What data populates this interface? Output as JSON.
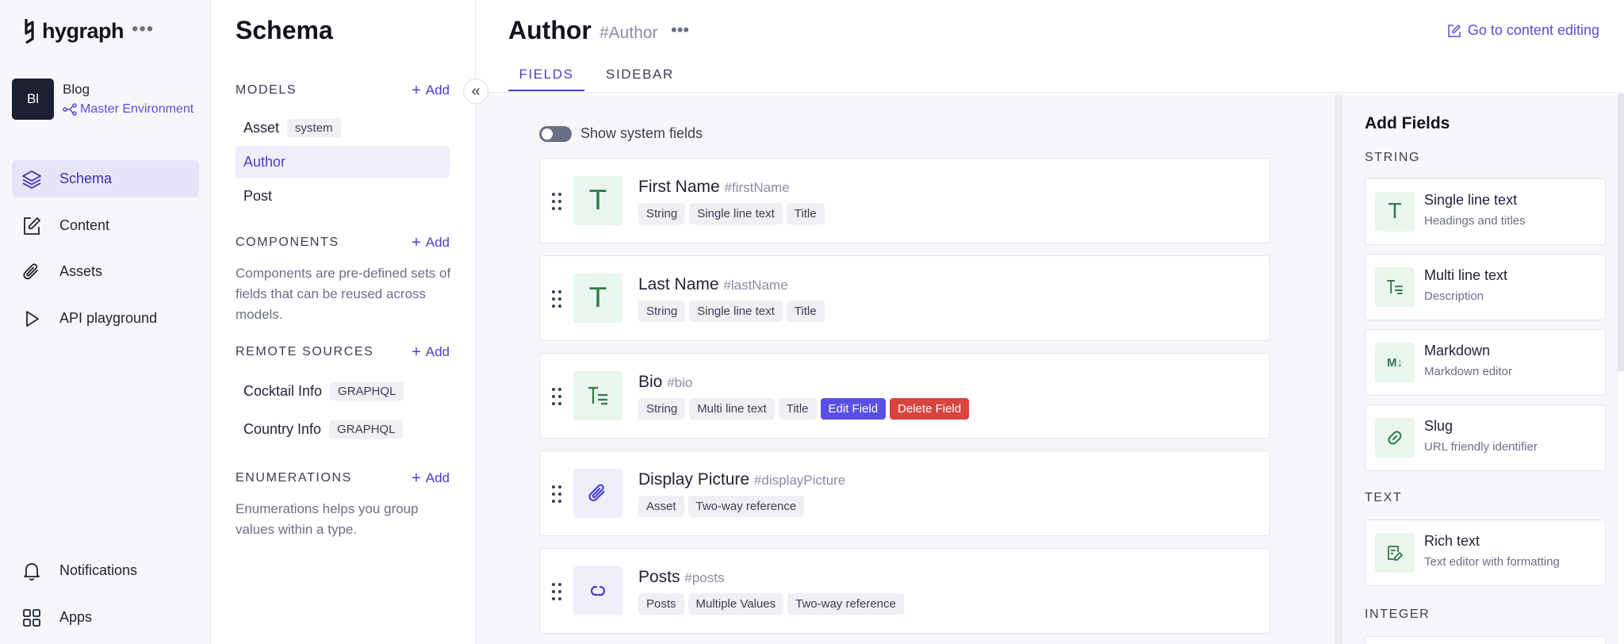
{
  "brand": {
    "name": "hygraph"
  },
  "project": {
    "initials": "Bl",
    "name": "Blog",
    "environment": "Master Environment"
  },
  "nav": {
    "items": [
      {
        "label": "Schema",
        "icon": "layers-icon"
      },
      {
        "label": "Content",
        "icon": "edit-icon"
      },
      {
        "label": "Assets",
        "icon": "paperclip-icon"
      },
      {
        "label": "API playground",
        "icon": "play-icon"
      }
    ],
    "bottom": [
      {
        "label": "Notifications",
        "icon": "bell-icon"
      },
      {
        "label": "Apps",
        "icon": "apps-icon"
      }
    ]
  },
  "schema": {
    "title": "Schema",
    "add_label": "Add",
    "models_title": "MODELS",
    "models": [
      {
        "name": "Asset",
        "tag": "system"
      },
      {
        "name": "Author"
      },
      {
        "name": "Post"
      }
    ],
    "components_title": "COMPONENTS",
    "components_desc": "Components are pre-defined sets of fields that can be reused across models.",
    "remote_title": "REMOTE SOURCES",
    "remotes": [
      {
        "name": "Cocktail Info",
        "tag": "GRAPHQL"
      },
      {
        "name": "Country Info",
        "tag": "GRAPHQL"
      }
    ],
    "enums_title": "ENUMERATIONS",
    "enums_desc": "Enumerations helps you group values within a type."
  },
  "main": {
    "title": "Author",
    "api_id": "#Author",
    "goto_label": "Go to content editing",
    "tabs": [
      "FIELDS",
      "SIDEBAR"
    ],
    "show_system_fields": "Show system fields",
    "fields": [
      {
        "name": "First Name",
        "api": "#firstName",
        "chips": [
          "String",
          "Single line text",
          "Title"
        ]
      },
      {
        "name": "Last Name",
        "api": "#lastName",
        "chips": [
          "String",
          "Single line text",
          "Title"
        ]
      },
      {
        "name": "Bio",
        "api": "#bio",
        "chips": [
          "String",
          "Multi line text",
          "Title"
        ],
        "edit": "Edit Field",
        "delete": "Delete Field"
      },
      {
        "name": "Display Picture",
        "api": "#displayPicture",
        "chips": [
          "Asset",
          "Two-way reference"
        ]
      },
      {
        "name": "Posts",
        "api": "#posts",
        "chips": [
          "Posts",
          "Multiple Values",
          "Two-way reference"
        ]
      }
    ]
  },
  "add_fields": {
    "title": "Add Fields",
    "string_title": "STRING",
    "string_items": [
      {
        "name": "Single line text",
        "desc": "Headings and titles"
      },
      {
        "name": "Multi line text",
        "desc": "Description"
      },
      {
        "name": "Markdown",
        "desc": "Markdown editor"
      },
      {
        "name": "Slug",
        "desc": "URL friendly identifier"
      }
    ],
    "text_title": "TEXT",
    "text_items": [
      {
        "name": "Rich text",
        "desc": "Text editor with formatting"
      }
    ],
    "integer_title": "INTEGER"
  },
  "colors": {
    "accent": "#4a3fd0",
    "danger": "#d9443c",
    "edit": "#5850e6"
  }
}
